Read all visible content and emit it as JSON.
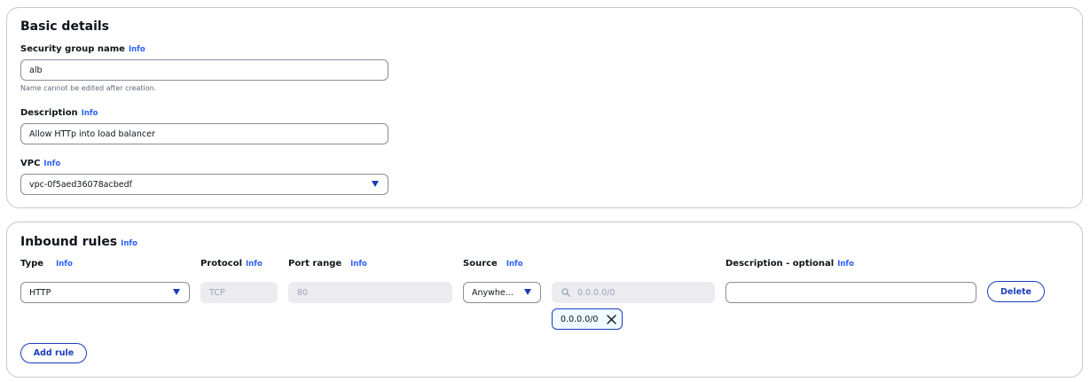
{
  "basic": {
    "title": "Basic details",
    "name_label": "Security group name",
    "info": "Info",
    "name_value": "alb",
    "name_hint": "Name cannot be edited after creation.",
    "desc_label": "Description",
    "desc_value": "Allow HTTp into load balancer",
    "vpc_label": "VPC",
    "vpc_value": "vpc-0f5aed36078acbedf"
  },
  "inbound": {
    "title": "Inbound rules",
    "info": "Info",
    "columns": {
      "type": "Type",
      "protocol": "Protocol",
      "port_range": "Port range",
      "source": "Source",
      "description": "Description - optional"
    },
    "rule": {
      "type": "HTTP",
      "protocol": "TCP",
      "port_range": "80",
      "source": "Anywhe...",
      "cidr_placeholder": "0.0.0.0/0",
      "cidr_token": "0.0.0.0/0",
      "description": ""
    },
    "delete_label": "Delete",
    "add_rule_label": "Add rule"
  },
  "colors": {
    "accent": "#1b3cbd",
    "info_link": "#295eff",
    "border": "#c6c6cd",
    "disabled_bg": "#ebebf0"
  }
}
